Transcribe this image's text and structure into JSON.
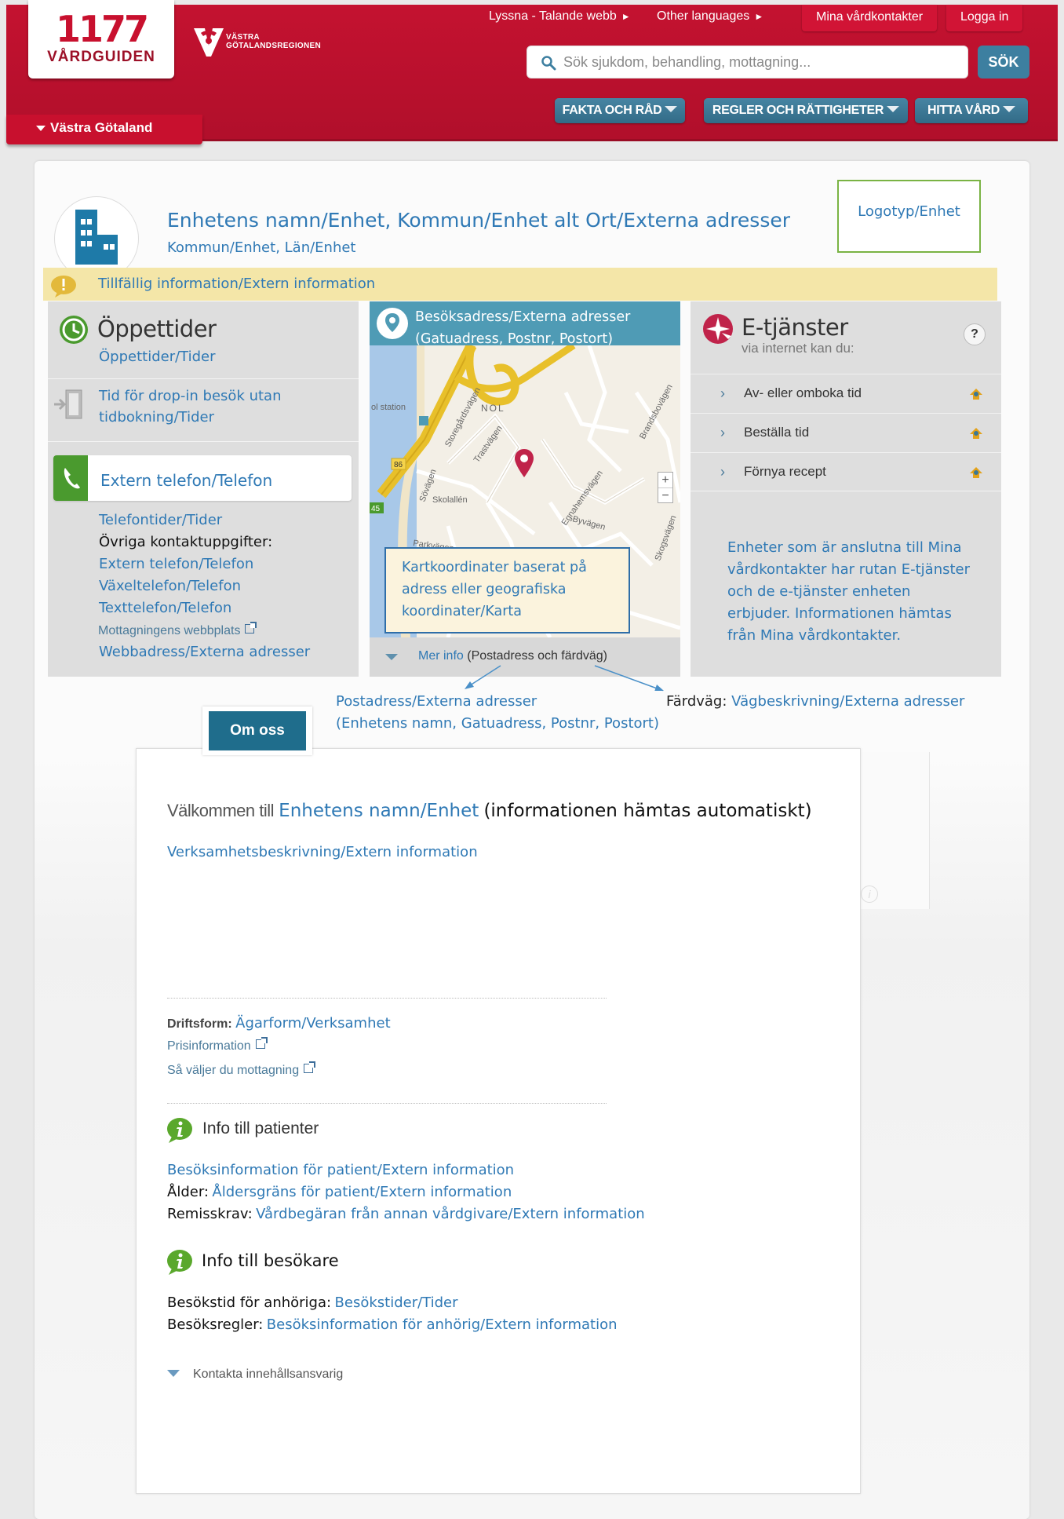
{
  "header": {
    "logo_number": "1177",
    "logo_text": "VÅRDGUIDEN",
    "region_logo_line1": "VÄSTRA",
    "region_logo_line2": "GÖTALANDSREGIONEN",
    "listen_link": "Lyssna - Talande webb",
    "languages_link": "Other languages",
    "contacts_button": "Mina vårdkontakter",
    "login_button": "Logga in",
    "search_placeholder": "Sök sjukdom, behandling, mottagning...",
    "search_button": "SÖK",
    "nav": [
      "FAKTA OCH RÅD",
      "REGLER OCH RÄTTIGHETER",
      "HITTA VÅRD"
    ],
    "region_tab": "Västra Götaland"
  },
  "unit": {
    "title": "Enhetens namn/Enhet, Kommun/Enhet alt Ort/Externa adresser",
    "subtitle": "Kommun/Enhet, Län/Enhet",
    "logo_placeholder": "Logotyp/Enhet",
    "temp_info": "Tillfällig information/Extern information"
  },
  "opening": {
    "heading": "Öppettider",
    "hours_link": "Öppettider/Tider",
    "dropin_line1": "Tid för drop-in besök utan",
    "dropin_line2": "tidbokning/Tider",
    "phone_heading": "Extern telefon/Telefon",
    "phone_hours": "Telefontider/Tider",
    "other_contacts_label": "Övriga kontaktuppgifter:",
    "external_phone": "Extern telefon/Telefon",
    "switchboard": "Växeltelefon/Telefon",
    "text_phone": "Texttelefon/Telefon",
    "clinic_website": "Mottagningens webbplats",
    "web_address": "Webbadress/Externa adresser"
  },
  "map": {
    "header_line1": "Besöksadress/Externa adresser",
    "header_line2": "(Gatuadress, Postnr, Postort)",
    "coord_line1": "Kartkoordinater baserat på",
    "coord_line2": "adress eller geografiska",
    "coord_line3": "koordinater/Karta",
    "more_info_link": "Mer info",
    "more_info_note": "(Postadress och färdväg)",
    "labels": [
      "ol station",
      "NOL",
      "Storegårdsvägen",
      "Trastvägen",
      "Brandsbovägen",
      "Egnahemsvägen",
      "Byvägen",
      "Skogsvägen",
      "Parkvägen",
      "Sövägen",
      "Skolallén",
      "86",
      "45"
    ]
  },
  "eservices": {
    "heading": "E-tjänster",
    "subheading": "via internet kan du:",
    "help_label": "?",
    "items": [
      "Av- eller omboka tid",
      "Beställa tid",
      "Förnya recept"
    ],
    "info": "Enheter som är anslutna till Mina vårdkontakter har rutan E-tjänster och de e-tjänster enheten erbjuder. Informationen hämtas från Mina vårdkontakter."
  },
  "annotations": {
    "postal_line1": "Postadress/Externa adresser",
    "postal_line2": "(Enhetens namn, Gatuadress, Postnr, Postort)",
    "route_label": "Färdväg:",
    "route_link": "Vägbeskrivning/Externa adresser"
  },
  "about": {
    "tab_label": "Om oss",
    "welcome_label": "Välkommen till",
    "welcome_unit": "Enhetens namn/Enhet",
    "welcome_note": "(informationen hämtas automatiskt)",
    "description": "Verksamhetsbeskrivning/Extern information",
    "operation_label": "Driftsform:",
    "operation_value": "Ägarform/Verksamhet",
    "price_link": "Prisinformation",
    "choose_link": "Så väljer du mottagning",
    "patients_heading": "Info till patienter",
    "patients_visit_info": "Besöksinformation för patient/Extern information",
    "age_label": "Ålder:",
    "age_value": "Åldersgräns för patient/Extern information",
    "referral_label": "Remisskrav:",
    "referral_value": "Vårdbegäran från annan vårdgivare/Extern information",
    "visitors_heading": "Info till besökare",
    "visiting_hours_label": "Besökstid för anhöriga:",
    "visiting_hours_value": "Besökstider/Tider",
    "visiting_rules_label": "Besöksregler:",
    "visiting_rules_value": "Besöksinformation för anhörig/Extern information",
    "contact_link": "Kontakta innehållsansvarig"
  },
  "colors": {
    "header_red": "#c41230",
    "nav_blue": "#3b7896",
    "link_blue": "#2f79b5",
    "info_yellow": "#f4e6a8",
    "annotation_green": "#7ab344",
    "phone_green": "#4a9a2e"
  }
}
